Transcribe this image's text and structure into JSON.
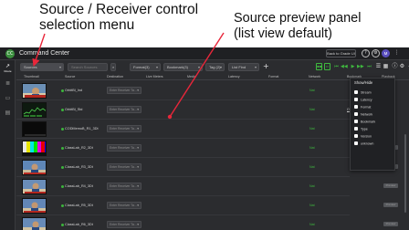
{
  "annotations": {
    "left_line1": "Source / Receiver control",
    "left_line2": "selection menu",
    "right_line1": "Source preview panel",
    "right_line2": "(list view default)"
  },
  "app": {
    "title": "Command Center",
    "logo_text": "CC",
    "back_button": "Back to Grade UI",
    "help_icon": "?",
    "settings_icon": "⚙",
    "user_initials": "M"
  },
  "sidebar": [
    {
      "icon": "↗",
      "label": "Route"
    },
    {
      "icon": "≣",
      "label": ""
    },
    {
      "icon": "▭",
      "label": ""
    },
    {
      "icon": "▤",
      "label": ""
    }
  ],
  "filters": {
    "source": "Sources",
    "search_placeholder": "Search Sources",
    "format": "Format(3)",
    "bookmark": "Bookmark(3)",
    "tag": "Tag (2)",
    "list": "List Find"
  },
  "columns": [
    "Thumbnail",
    "Source",
    "Destination",
    "Live Meters",
    "Media",
    "Latency",
    "Format",
    "Network",
    "Bookmark",
    "Playback"
  ],
  "rows": [
    {
      "name": "OrbitBl_Ind",
      "destination": "Enter Receiver Ta...",
      "network": "Nat",
      "bookmark": "",
      "playback": ""
    },
    {
      "name": "OrbitBl_Std",
      "destination": "Enter Receiver Ta...",
      "network": "Nat",
      "bookmark": "Obj",
      "playback": ""
    },
    {
      "name": "CODMemoB_R1_3Dt",
      "destination": "Enter Receiver Ta...",
      "network": "Nat",
      "bookmark": "",
      "playback": ""
    },
    {
      "name": "ClassLab_R2_3Dt",
      "destination": "Enter Receiver Ta...",
      "network": "Nat",
      "bookmark": "",
      "playback": "Preview"
    },
    {
      "name": "ClassLab_R3_3Dt",
      "destination": "Enter Receiver Ta...",
      "network": "Nat",
      "bookmark": "",
      "playback": "Preview"
    },
    {
      "name": "ClassLab_R4_3Dt",
      "destination": "Enter Receiver Ta...",
      "network": "Nat",
      "bookmark": "",
      "playback": "Preview"
    },
    {
      "name": "ClassLab_R5_3Dt",
      "destination": "Enter Receiver Ta...",
      "network": "Nat",
      "bookmark": "",
      "playback": "Preview"
    },
    {
      "name": "ClassLab_R6_3Dt",
      "destination": "Enter Receiver Ta...",
      "network": "Nat",
      "bookmark": "",
      "playback": "Preview"
    }
  ],
  "column_popup": {
    "title": "Show/Hide",
    "items": [
      "Stream",
      "Latency",
      "Format",
      "Network",
      "Bookmark",
      "Type",
      "Version",
      "unknown"
    ]
  },
  "colors": {
    "accent": "#3fb83f",
    "background": "#2b2c2f",
    "annotation_arrow": "#e8263a"
  }
}
